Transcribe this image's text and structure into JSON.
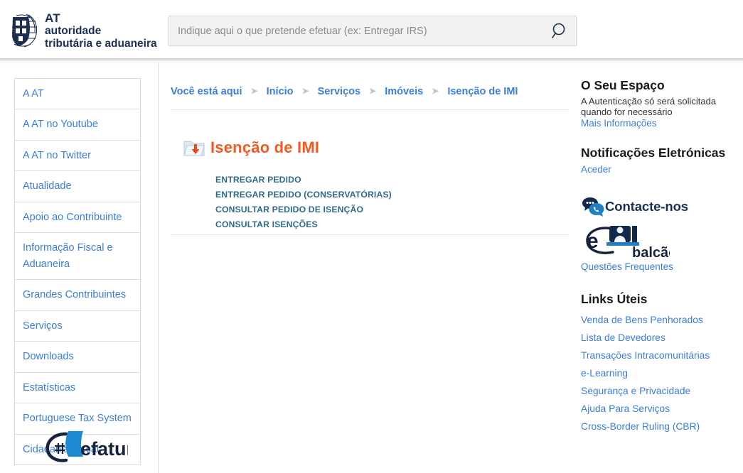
{
  "header": {
    "logo": {
      "icon": "at-shield-logo",
      "line1": "AT",
      "line2": "autoridade",
      "line3": "tributária e aduaneira"
    },
    "search": {
      "placeholder": "Indique aqui o que pretende efetuar (ex: Entregar IRS)",
      "value": "",
      "button_icon": "search-icon"
    }
  },
  "sidebar": {
    "items": [
      {
        "label": "A AT"
      },
      {
        "label": "A AT no Youtube"
      },
      {
        "label": "A AT no Twitter"
      },
      {
        "label": "Atualidade"
      },
      {
        "label": "Apoio ao Contribuinte"
      },
      {
        "label": "Informação Fiscal e Aduaneira"
      },
      {
        "label": "Grandes Contribuintes"
      },
      {
        "label": "Serviços"
      },
      {
        "label": "Downloads"
      },
      {
        "label": "Estatísticas"
      },
      {
        "label": "Portuguese Tax System"
      },
      {
        "label": "Cidadania Fiscal"
      }
    ],
    "efatura_logo": "efatura-logo"
  },
  "breadcrumb": {
    "prefix": "Você está aqui",
    "separator": "➤",
    "items": [
      {
        "label": "Início"
      },
      {
        "label": "Serviços"
      },
      {
        "label": "Imóveis"
      },
      {
        "label": "Isenção de IMI"
      }
    ]
  },
  "main": {
    "icon": "folder-download-icon",
    "title": "Isenção de IMI",
    "links": [
      {
        "label": "ENTREGAR PEDIDO"
      },
      {
        "label": "ENTREGAR PEDIDO (CONSERVATÓRIAS)"
      },
      {
        "label": "CONSULTAR PEDIDO DE ISENÇÃO"
      },
      {
        "label": "CONSULTAR ISENÇÕES"
      }
    ]
  },
  "rail": {
    "espaco": {
      "title": "O Seu Espaço",
      "text_line1": "A Autenticação só será solicitada",
      "text_line2": "quando for necessário",
      "link": "Mais Informações"
    },
    "notificacoes": {
      "title": "Notificações Eletrónicas",
      "link": "Aceder"
    },
    "contacte": {
      "icon": "chat-bubbles-phone-icon",
      "label": "Contacte-nos"
    },
    "ebalcao": {
      "icon": "ebalcao-logo",
      "link": "Questões Frequentes"
    },
    "links_uteis": {
      "title": "Links Úteis",
      "items": [
        {
          "label": "Venda de Bens Penhorados"
        },
        {
          "label": "Lista de Devedores"
        },
        {
          "label": "Transações Intracomunitárias"
        },
        {
          "label": "e-Learning"
        },
        {
          "label": "Segurança e Privacidade"
        },
        {
          "label": "Ajuda Para Serviços"
        },
        {
          "label": "Cross-Border Ruling (CBR)"
        }
      ]
    }
  },
  "colors": {
    "link_blue": "#3b7dd8",
    "brand_navy": "#1b2f52",
    "title_orange": "#f15a22",
    "action_teal": "#2e6b8a"
  }
}
